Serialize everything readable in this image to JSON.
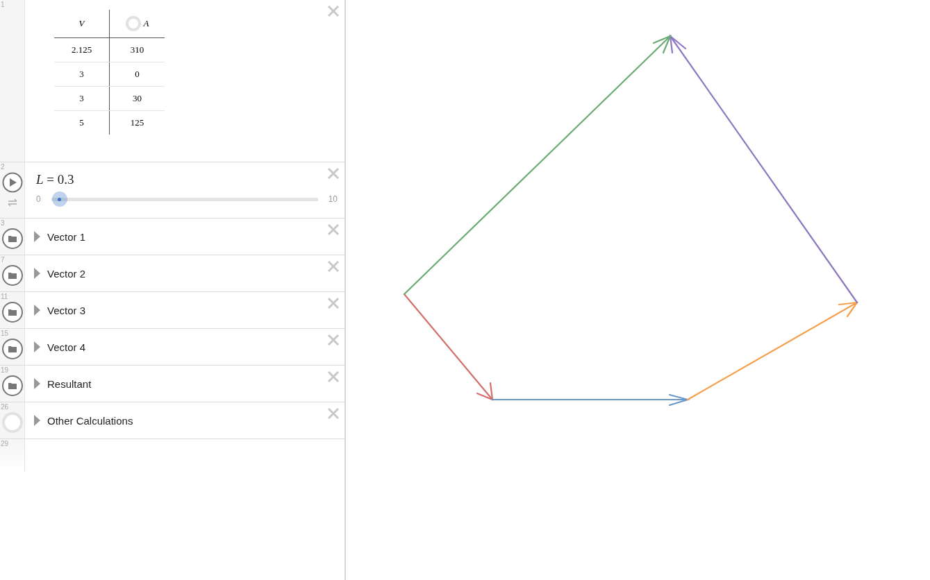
{
  "expressions": [
    {
      "kind": "table",
      "index": "1",
      "columns": [
        {
          "heading": "V"
        },
        {
          "heading": "A",
          "shown": false
        }
      ],
      "rows": [
        [
          "2.125",
          "310"
        ],
        [
          "3",
          "0"
        ],
        [
          "3",
          "30"
        ],
        [
          "5",
          "125"
        ]
      ]
    },
    {
      "kind": "slider",
      "index": "2",
      "expression": "*L* = 0.3",
      "min": "0",
      "max": "10",
      "level": 0.03
    },
    {
      "kind": "folder",
      "index": "3",
      "label": "Vector 1",
      "shown": true,
      "expanded": false
    },
    {
      "kind": "folder",
      "index": "7",
      "label": "Vector 2",
      "shown": true,
      "expanded": false
    },
    {
      "kind": "folder",
      "index": "11",
      "label": "Vector 3",
      "shown": true,
      "expanded": false
    },
    {
      "kind": "folder",
      "index": "15",
      "label": "Vector 4",
      "shown": true,
      "expanded": false
    },
    {
      "kind": "folder",
      "index": "19",
      "label": "Resultant",
      "shown": true,
      "expanded": false
    },
    {
      "kind": "folder",
      "index": "26",
      "label": "Other Calculations",
      "shown": false,
      "expanded": false
    },
    {
      "kind": "empty",
      "index": "29"
    }
  ]
}
